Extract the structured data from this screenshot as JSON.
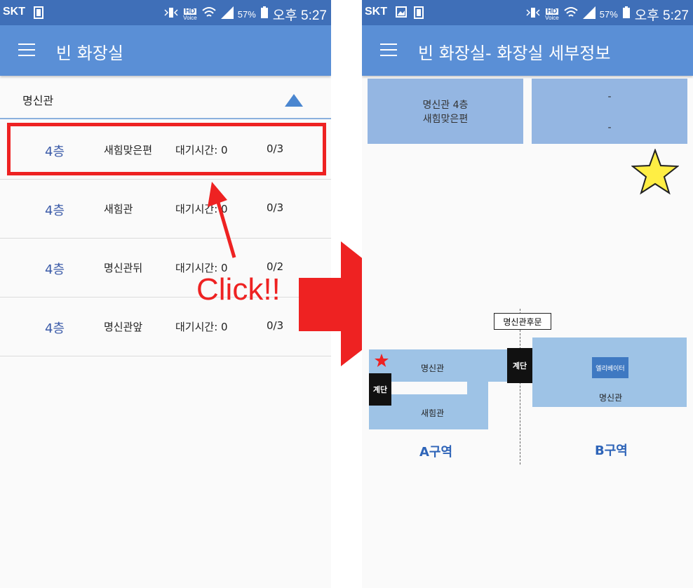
{
  "statusbar": {
    "carrier": "SKT",
    "volte_label": "HD",
    "volte_sub": "Voice",
    "battery": "57%",
    "time": "오후 5:27"
  },
  "left_screen": {
    "title": "빈 화장실",
    "group": "명신관",
    "rows": [
      {
        "floor": "4층",
        "name": "새힘맞은편",
        "wait": "대기시간: 0",
        "count": "0/3"
      },
      {
        "floor": "4층",
        "name": "새힘관",
        "wait": "대기시간: 0",
        "count": "0/3"
      },
      {
        "floor": "4층",
        "name": "명신관뒤",
        "wait": "대기시간: 0",
        "count": "0/2"
      },
      {
        "floor": "4층",
        "name": "명신관앞",
        "wait": "대기시간: 0",
        "count": "0/3"
      }
    ]
  },
  "annotation": {
    "click_text": "Click!!",
    "color": "#ee2222"
  },
  "right_screen": {
    "title": "빈 화장실- 화장실 세부정보",
    "info_left_line1": "명신관 4층",
    "info_left_line2": "새힘맞은편",
    "info_right_line1": "-",
    "info_right_line2": "-",
    "map": {
      "gate_label": "명신관후문",
      "building_a_top": "명신관",
      "building_a_bottom": "새힘관",
      "stairs_left": "계단",
      "stairs_mid": "계단",
      "elevator": "엘리베이터",
      "building_b": "명신관",
      "zone_a": "A구역",
      "zone_b": "B구역"
    }
  },
  "colors": {
    "statusbar": "#3f6fb8",
    "appbar": "#5a8fd6",
    "info_box": "#94b6e2",
    "map_block": "#9ec3e6",
    "star_fill": "#ffee44"
  }
}
